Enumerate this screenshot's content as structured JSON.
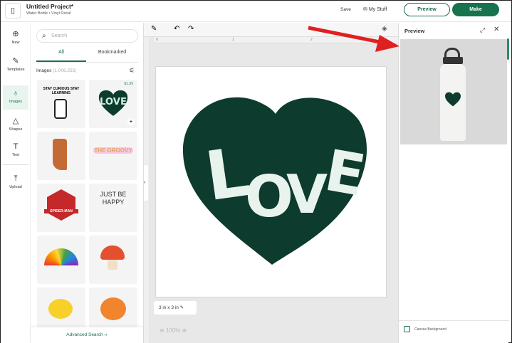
{
  "header": {
    "title": "Untitled Project*",
    "subtitle": "Water Bottle • Vinyl Decal",
    "save": "Save",
    "my_stuff": "My Stuff",
    "preview": "Preview",
    "make": "Make"
  },
  "rail": [
    {
      "label": "New",
      "icon": "plus-circle-icon"
    },
    {
      "label": "Templates",
      "icon": "templates-icon"
    },
    {
      "label": "Images",
      "icon": "images-icon"
    },
    {
      "label": "Shapes",
      "icon": "shapes-icon"
    },
    {
      "label": "Text",
      "icon": "text-icon"
    },
    {
      "label": "Upload",
      "icon": "upload-icon"
    }
  ],
  "panel": {
    "search_placeholder": "Search",
    "tabs": [
      "All",
      "Bookmarked"
    ],
    "images_label": "Images",
    "images_count": "(1,006,255)",
    "price": "$1.99",
    "advanced_search": "Advanced Search  ››",
    "tiles": [
      "STAY CURIOUS STAY LEARNING",
      "LOVE",
      "boot",
      "THE GROOVY",
      "SPIDER-MAN",
      "JUST BE HAPPY",
      "rainbow",
      "mushroom",
      "lemon",
      "tiger"
    ]
  },
  "canvas": {
    "design_text": "LOVE",
    "size": "3 in x 3 in",
    "zoom": "100%",
    "ruler_marks": [
      "0",
      "1",
      "2"
    ],
    "design_color": "#0d3b2e",
    "letter_color": "#e9f3ee"
  },
  "preview": {
    "title": "Preview",
    "canvas_background": "Canvas Background"
  },
  "colors": {
    "accent": "#17734d",
    "arrow": "#e02020"
  }
}
